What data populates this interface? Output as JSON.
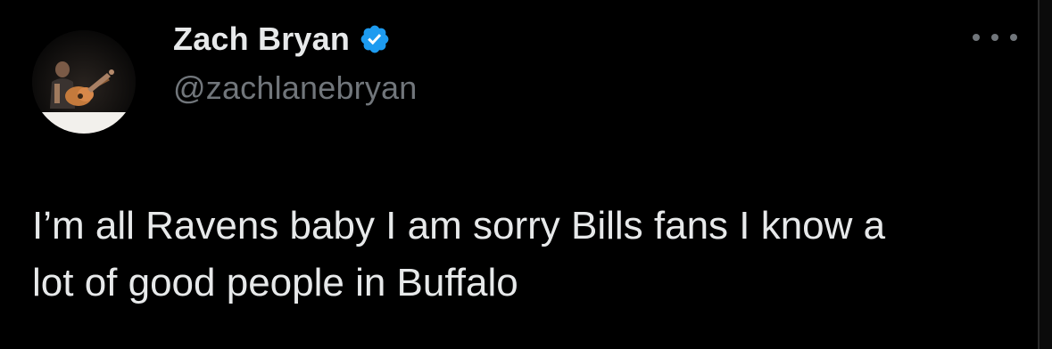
{
  "author": {
    "display_name": "Zach Bryan",
    "handle": "@zachlanebryan",
    "verified": true
  },
  "tweet": {
    "text": "I’m all Ravens baby I am sorry Bills fans I know a\nlot of good people in Buffalo"
  },
  "icons": {
    "avatar": "avatar-photo-icon",
    "verified": "verified-badge-icon",
    "more": "more-options-icon"
  },
  "colors": {
    "background": "#000000",
    "primary_text": "#e7e9ea",
    "secondary_text": "#71767b",
    "verified_blue": "#1d9bf0"
  }
}
